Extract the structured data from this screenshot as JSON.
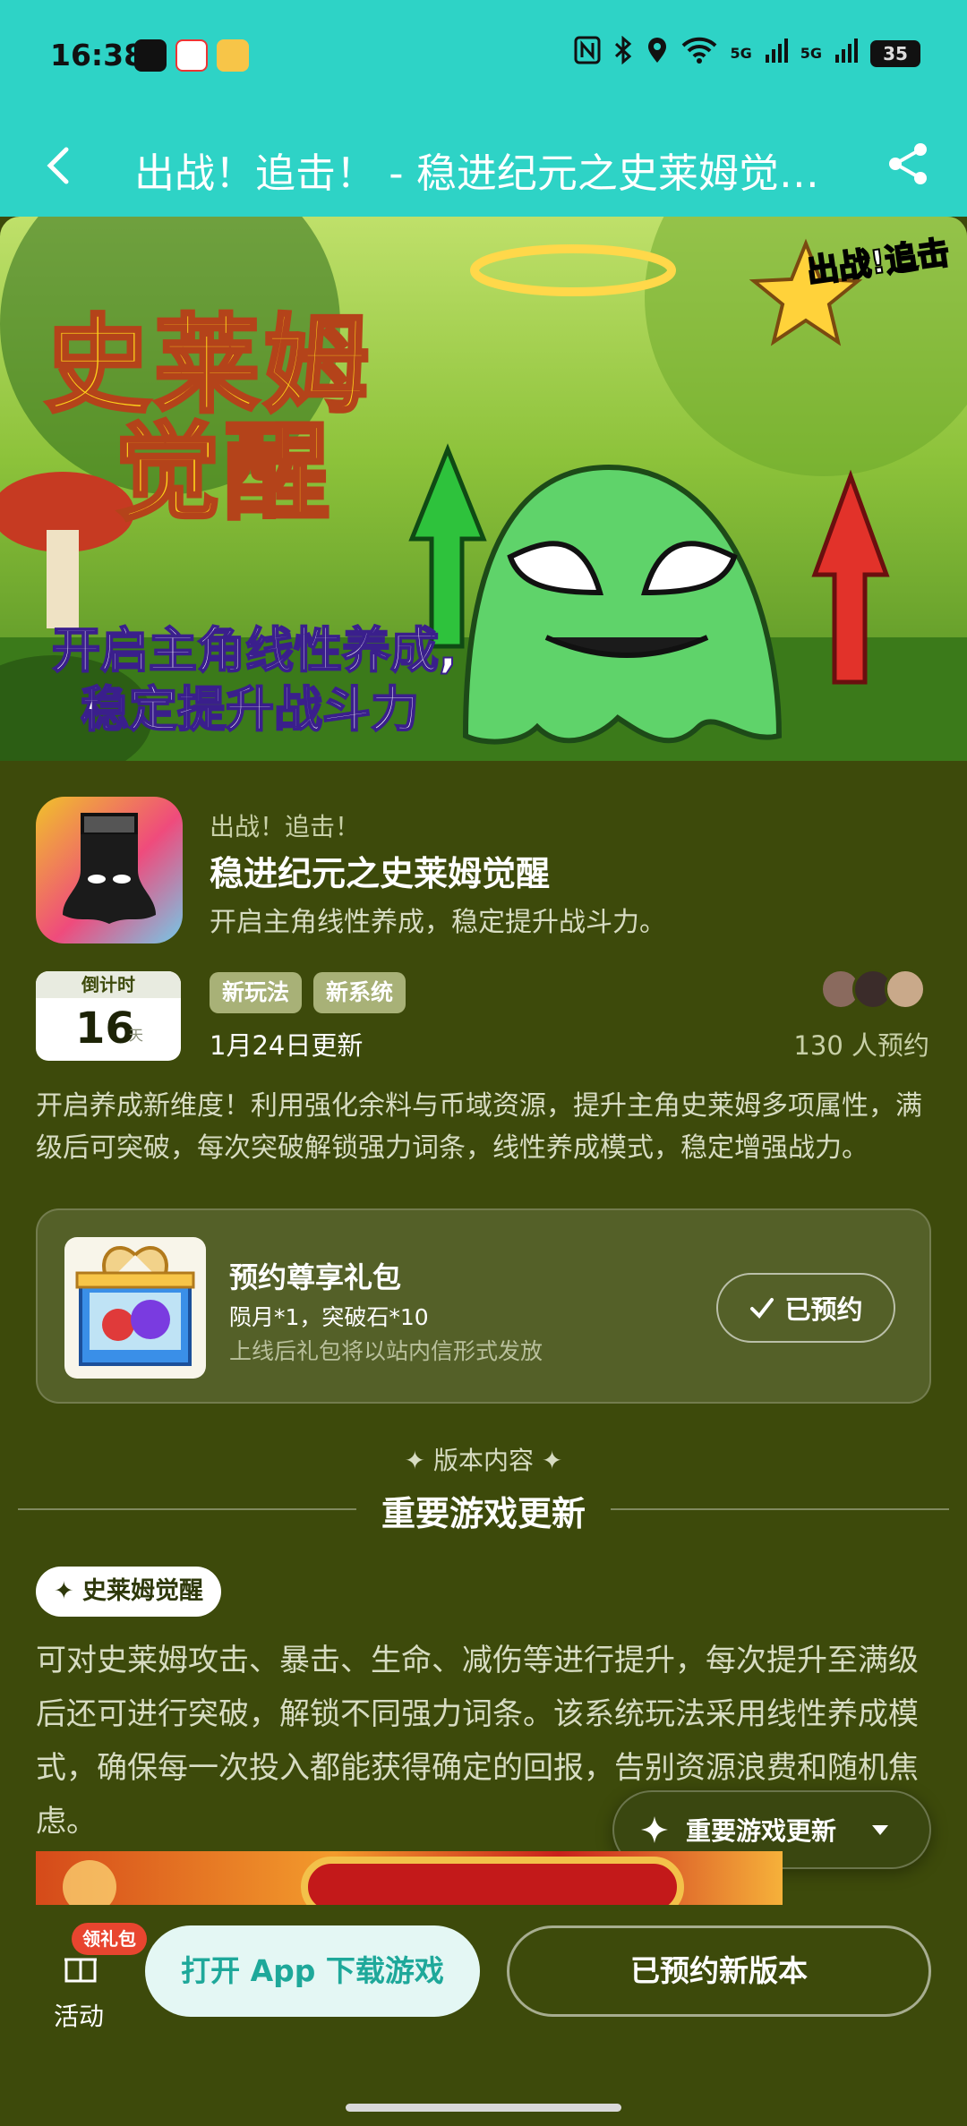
{
  "status_bar": {
    "time": "16:38",
    "network_1": "5G",
    "network_2": "5G",
    "battery": "35"
  },
  "nav": {
    "title": "出战！追击！ - 稳进纪元之史莱姆觉醒…"
  },
  "banner": {
    "title_line1": "史莱姆",
    "title_line2": "觉醒",
    "subtitle_line1": "开启主角线性养成,",
    "subtitle_line2": "稳定提升战斗力",
    "brand_tag": "出战!追击"
  },
  "app": {
    "developer": "出战！追击！",
    "name": "稳进纪元之史莱姆觉醒",
    "slogan": "开启主角线性养成，稳定提升战斗力。",
    "countdown_label": "倒计时",
    "countdown_value": "16",
    "countdown_unit": "天",
    "tags": [
      "新玩法",
      "新系统"
    ],
    "update_date": "1月24日更新",
    "reserve_count": "130 人预约",
    "description": "开启养成新维度！利用强化余料与币域资源，提升主角史莱姆多项属性，满级后可突破，每次突破解锁强力词条，线性养成模式，稳定增强战力。"
  },
  "gift": {
    "title": "预约尊享礼包",
    "items": "陨月*1，突破石*10",
    "note": "上线后礼包将以站内信形式发放",
    "button": "已预约"
  },
  "section": {
    "kicker": "版本内容",
    "title": "重要游戏更新",
    "chip": "史莱姆觉醒",
    "body": "可对史莱姆攻击、暴击、生命、减伤等进行提升，每次提升至满级后还可进行突破，解锁不同强力词条。该系统玩法采用线性养成模式，确保每一次投入都能获得确定的回报，告别资源浪费和随机焦虑。"
  },
  "floating_nav": {
    "label": "重要游戏更新"
  },
  "bottom": {
    "activity_badge": "领礼包",
    "activity_label": "活动",
    "open_button": "打开 App 下载游戏",
    "reserved_button": "已预约新版本"
  },
  "colors": {
    "header": "#2ed3c6",
    "page_bg": "#3d4a0b",
    "accent": "#1ea89a",
    "badge": "#e8452f"
  }
}
